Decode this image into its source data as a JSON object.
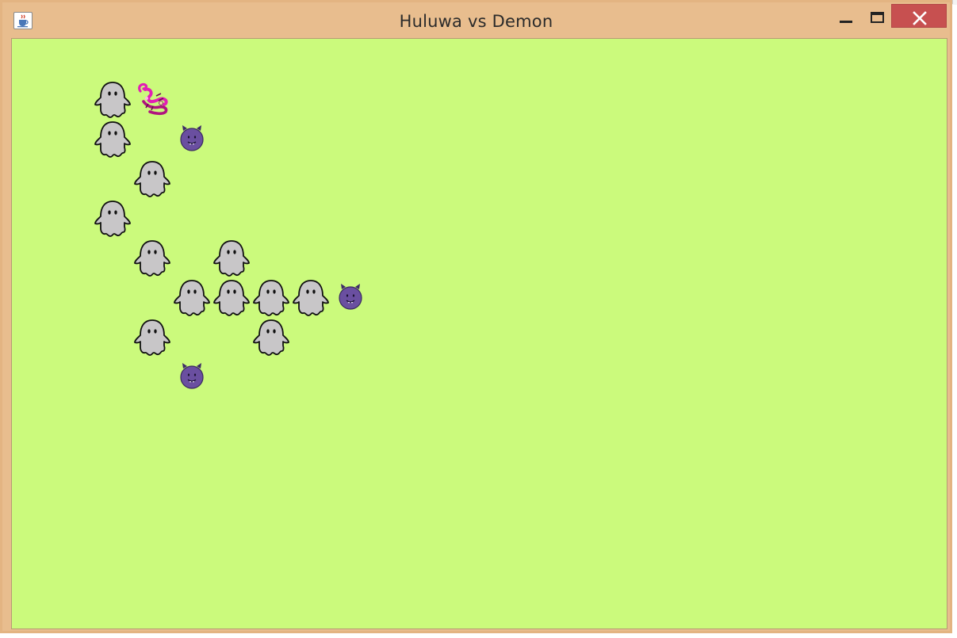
{
  "window": {
    "title": "Huluwa vs Demon",
    "controls": [
      "minimize",
      "maximize",
      "close"
    ]
  },
  "colors": {
    "frame": "#e8bd8e",
    "battlefield": "#cbfa7c",
    "close_button": "#c75050",
    "ghost_fill": "#c8c6c8",
    "demon_fill": "#6a4fa0",
    "scorpion": "#e21fb5"
  },
  "icons": {
    "app": "java-cup-icon",
    "minion": "ghost-icon",
    "boss": "scorpion-icon",
    "lackey": "purple-demon-icon"
  },
  "battlefield": {
    "grid_columns": 1,
    "units": [
      {
        "type": "ghost",
        "row": 1,
        "col": 2
      },
      {
        "type": "scorpion",
        "row": 1,
        "col": 3
      },
      {
        "type": "ghost",
        "row": 2,
        "col": 2
      },
      {
        "type": "demon",
        "row": 2,
        "col": 4
      },
      {
        "type": "ghost",
        "row": 3,
        "col": 3
      },
      {
        "type": "ghost",
        "row": 4,
        "col": 2
      },
      {
        "type": "ghost",
        "row": 5,
        "col": 3
      },
      {
        "type": "ghost",
        "row": 5,
        "col": 5
      },
      {
        "type": "ghost",
        "row": 6,
        "col": 4
      },
      {
        "type": "ghost",
        "row": 6,
        "col": 5
      },
      {
        "type": "ghost",
        "row": 6,
        "col": 6
      },
      {
        "type": "ghost",
        "row": 6,
        "col": 7
      },
      {
        "type": "demon",
        "row": 6,
        "col": 8
      },
      {
        "type": "ghost",
        "row": 7,
        "col": 3
      },
      {
        "type": "ghost",
        "row": 7,
        "col": 6
      },
      {
        "type": "demon",
        "row": 8,
        "col": 4
      }
    ]
  }
}
